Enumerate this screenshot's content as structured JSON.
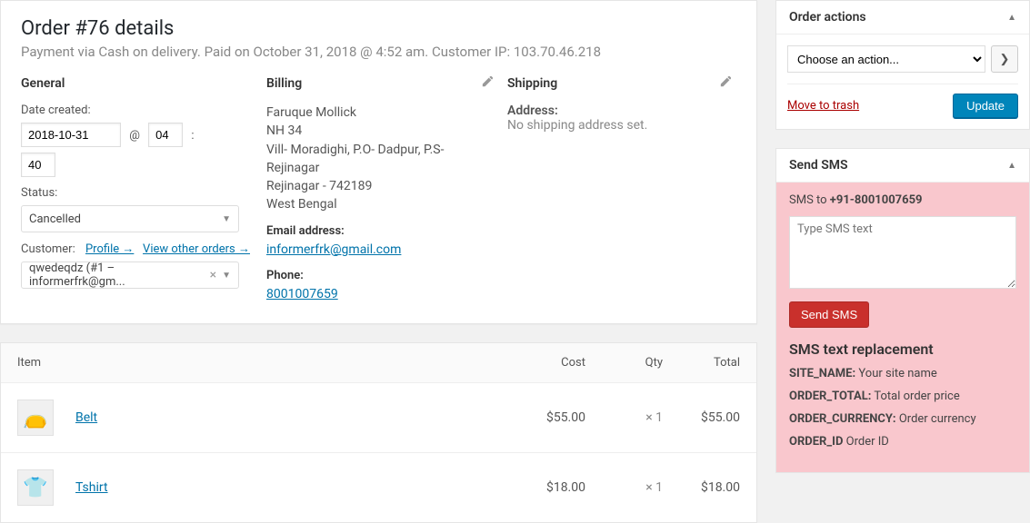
{
  "order": {
    "title": "Order #76 details",
    "subtitle": "Payment via Cash on delivery. Paid on October 31, 2018 @ 4:52 am. Customer IP: 103.70.46.218"
  },
  "general": {
    "heading": "General",
    "date_label": "Date created:",
    "date_value": "2018-10-31",
    "at_label": "@",
    "hour_value": "04",
    "colon_label": ":",
    "minute_value": "40",
    "status_label": "Status:",
    "status_value": "Cancelled",
    "customer_label": "Customer:",
    "profile_link": "Profile →",
    "other_orders_link": "View other orders →",
    "customer_value": "qwedeqdz (#1 – informerfrk@gm..."
  },
  "billing": {
    "heading": "Billing",
    "name": "Faruque Mollick",
    "line1": "NH 34",
    "line2": "Vill- Moradighi, P.O- Dadpur, P.S- Rejinagar",
    "line3": "Rejinagar - 742189",
    "state": "West Bengal",
    "email_label": "Email address:",
    "email": "informerfrk@gmail.com",
    "phone_label": "Phone:",
    "phone": "8001007659"
  },
  "shipping": {
    "heading": "Shipping",
    "address_label": "Address:",
    "address_value": "No shipping address set."
  },
  "items": {
    "headers": {
      "item": "Item",
      "cost": "Cost",
      "qty": "Qty",
      "total": "Total"
    },
    "rows": [
      {
        "name": "Belt",
        "cost": "$55.00",
        "qty": "× 1",
        "total": "$55.00",
        "icon": "👝"
      },
      {
        "name": "Tshirt",
        "cost": "$18.00",
        "qty": "× 1",
        "total": "$18.00",
        "icon": "👕"
      }
    ]
  },
  "order_actions": {
    "heading": "Order actions",
    "select_placeholder": "Choose an action...",
    "trash": "Move to trash",
    "update": "Update"
  },
  "sms": {
    "heading": "Send SMS",
    "to_prefix": "SMS to ",
    "to_number": "+91-8001007659",
    "placeholder": "Type SMS text",
    "send_label": "Send SMS",
    "repl_title": "SMS text replacement",
    "replacements": [
      {
        "key": "SITE_NAME:",
        "desc": " Your site name"
      },
      {
        "key": "ORDER_TOTAL:",
        "desc": " Total order price"
      },
      {
        "key": "ORDER_CURRENCY:",
        "desc": " Order currency"
      },
      {
        "key": "ORDER_ID",
        "desc": " Order ID"
      }
    ]
  }
}
